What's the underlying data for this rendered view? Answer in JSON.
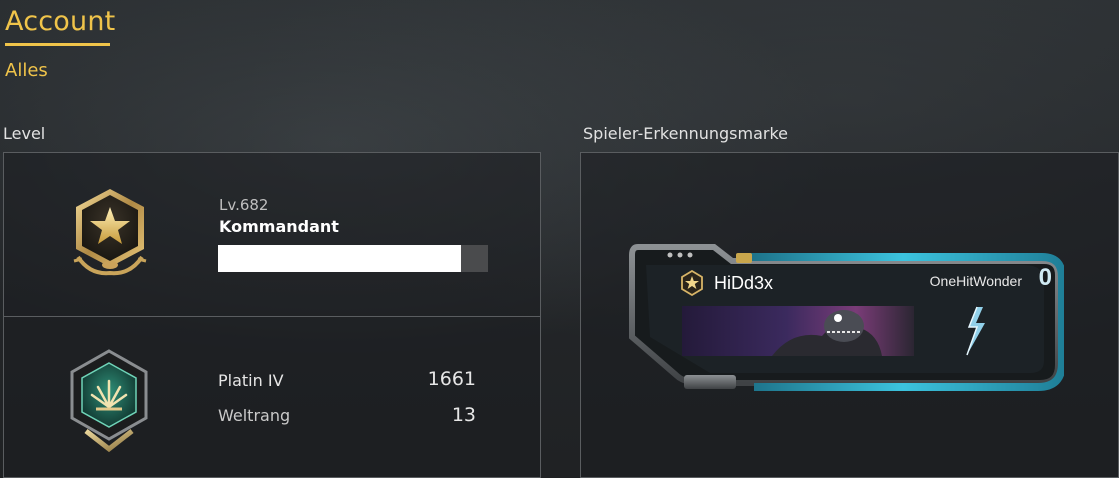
{
  "header": {
    "title": "Account",
    "filter": "Alles"
  },
  "level_section": {
    "label": "Level",
    "level_text": "Lv.682",
    "rank_title": "Kommandant",
    "xp_progress_fraction": 0.9
  },
  "ranked": {
    "tier": "Platin IV",
    "points": "1661",
    "world_rank_label": "Weltrang",
    "world_rank_value": "13"
  },
  "dogtag_section": {
    "label": "Spieler-Erkennungsmarke",
    "player_name": "HiDd3x",
    "player_title": "OneHitWonder",
    "counter": "0"
  },
  "icons": {
    "level_badge": "gold-star-hexagon-badge-icon",
    "ranked_badge": "platinum-rank-badge-icon",
    "dogtag_badge": "small-star-badge-icon",
    "lightning": "lightning-bolt-icon"
  },
  "colors": {
    "accent": "#f0c44a",
    "panel_border": "#5a5d60",
    "xp_fill": "#ffffff",
    "xp_track": "#4a4b4d",
    "dogtag_cyan": "#35b8d4"
  }
}
